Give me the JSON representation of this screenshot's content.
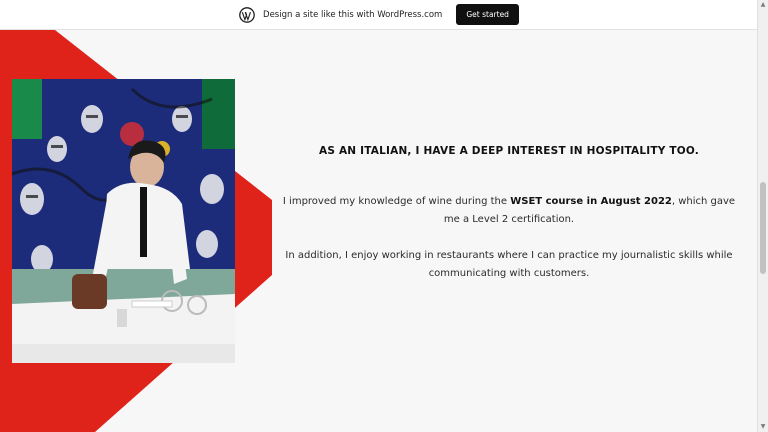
{
  "topbar": {
    "promo_text": "Design a site like this with WordPress.com",
    "cta_label": "Get started",
    "logo_icon": "wordpress-logo-icon"
  },
  "main": {
    "heading": "AS AN ITALIAN, I HAVE A DEEP INTEREST IN HOSPITALITY TOO.",
    "para1_before": "I improved my knowledge of wine during the ",
    "para1_bold": "WSET course in August 2022",
    "para1_after": ", which gave me a Level 2 certification.",
    "para2": "In addition, I enjoy working in restaurants where I can practice my journalistic skills while communicating with customers."
  },
  "colors": {
    "accent_red": "#e0231a",
    "background": "#f7f7f7",
    "button_bg": "#101010"
  },
  "scrollbar": {
    "up_arrow": "▲",
    "down_arrow": "▼"
  }
}
